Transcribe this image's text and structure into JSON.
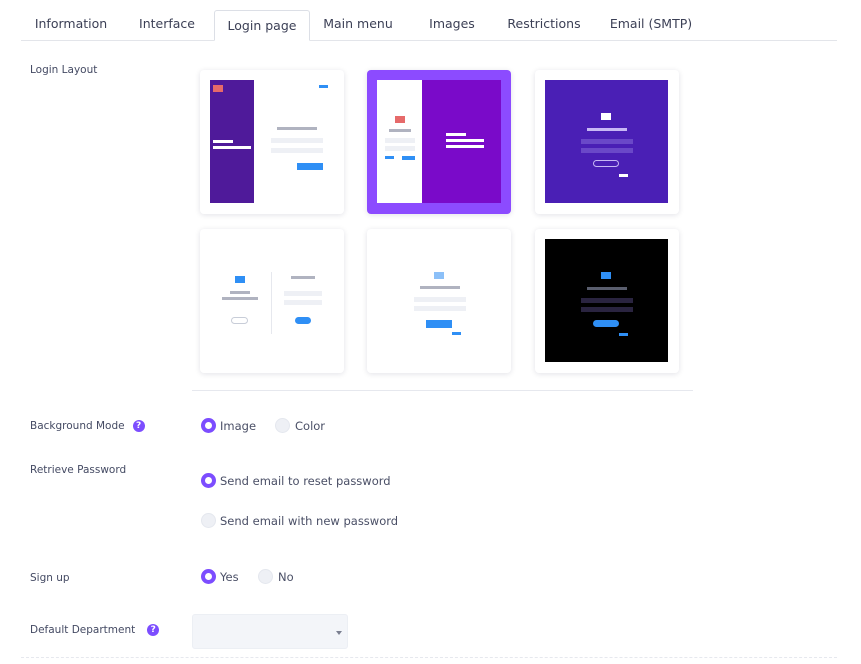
{
  "tabs": [
    {
      "label": "Information"
    },
    {
      "label": "Interface"
    },
    {
      "label": "Login page"
    },
    {
      "label": "Main menu"
    },
    {
      "label": "Images"
    },
    {
      "label": "Restrictions"
    },
    {
      "label": "Email (SMTP)"
    }
  ],
  "active_tab": "Login page",
  "login_layout": {
    "label": "Login Layout",
    "options": [
      {
        "name": "split-left-purple",
        "selected": false
      },
      {
        "name": "split-right-purple",
        "selected": true
      },
      {
        "name": "centered-purple",
        "selected": false
      },
      {
        "name": "white-two-column",
        "selected": false
      },
      {
        "name": "white-centered",
        "selected": false
      },
      {
        "name": "dark-centered",
        "selected": false
      }
    ]
  },
  "background_mode": {
    "label": "Background Mode",
    "help_icon": "question-icon",
    "options": [
      {
        "label": "Image",
        "checked": true
      },
      {
        "label": "Color",
        "checked": false
      }
    ]
  },
  "retrieve_password": {
    "label": "Retrieve Password",
    "options": [
      {
        "label": "Send email to reset password",
        "checked": true
      },
      {
        "label": "Send email with new password",
        "checked": false
      }
    ]
  },
  "sign_up": {
    "label": "Sign up",
    "options": [
      {
        "label": "Yes",
        "checked": true
      },
      {
        "label": "No",
        "checked": false
      }
    ]
  },
  "default_department": {
    "label": "Default Department",
    "help_icon": "question-icon",
    "value": ""
  },
  "colors": {
    "accent": "#7c4dff",
    "selected_card": "#8c4bff",
    "purple_dark": "#4f1a9a",
    "purple_bright": "#7a0ac9",
    "indigo": "#4a1fb5",
    "blue": "#2f8ff5",
    "dark_bg": "#000000"
  }
}
